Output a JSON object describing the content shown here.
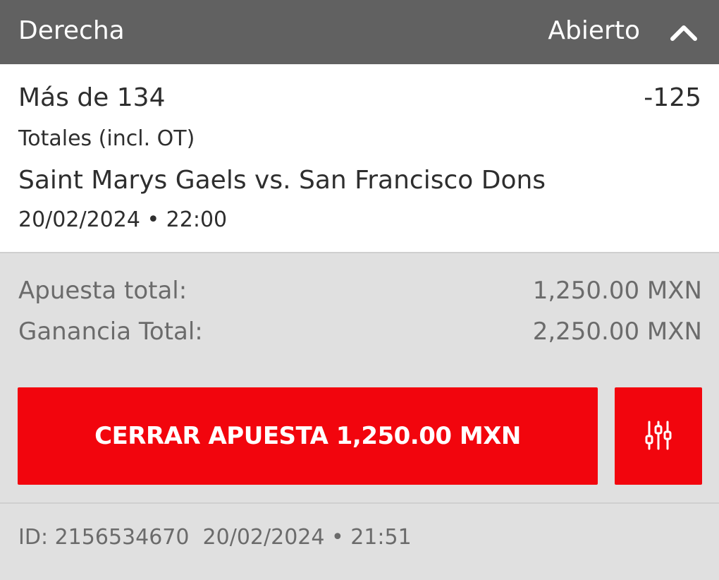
{
  "header": {
    "bet_type": "Derecha",
    "status": "Abierto",
    "toggle_icon": "chevron-up-icon"
  },
  "selection": {
    "market_name": "Más de 134",
    "odds": "-125",
    "market_type": "Totales (incl. OT)",
    "event_name": "Saint Marys Gaels vs. San Francisco Dons",
    "event_datetime": "20/02/2024 • 22:00"
  },
  "summary": {
    "stake_label": "Apuesta total:",
    "stake_value": "1,250.00 MXN",
    "win_label": "Ganancia Total:",
    "win_value": "2,250.00 MXN"
  },
  "actions": {
    "cashout_label": "CERRAR APUESTA 1,250.00 MXN",
    "settings_icon": "sliders-icon",
    "button_color": "#f2050d"
  },
  "footer": {
    "bet_id": "ID: 2156534670",
    "placed_datetime": "20/02/2024 • 21:51"
  },
  "colors": {
    "header_bg": "#616161",
    "body_bg": "#e0e0e0",
    "card_bg": "#ffffff"
  }
}
